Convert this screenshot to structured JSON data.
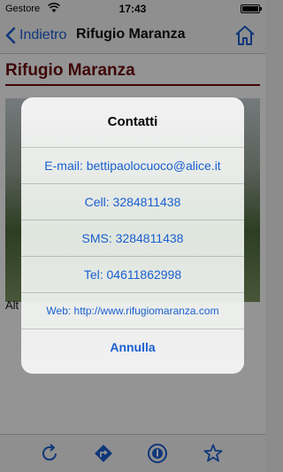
{
  "status_bar": {
    "carrier": "Gestore",
    "time": "17:43"
  },
  "nav": {
    "back_label": "Indietro",
    "title": "Rifugio Maranza"
  },
  "page": {
    "title": "Rifugio Maranza",
    "alt_label": "Alt"
  },
  "dialog": {
    "title": "Contatti",
    "options": [
      "E-mail: bettipaolocuoco@alice.it",
      "Cell: 3284811438",
      "SMS: 3284811438",
      "Tel: 04611862998",
      "Web: http://www.rifugiomaranza.com"
    ],
    "cancel": "Annulla"
  },
  "colors": {
    "accent": "#1a5fd0",
    "title_red": "#6b0a0a"
  },
  "icons": [
    "wifi-icon",
    "battery-icon",
    "back-chevron-icon",
    "home-icon",
    "refresh-icon",
    "directions-icon",
    "info-icon",
    "star-icon"
  ]
}
